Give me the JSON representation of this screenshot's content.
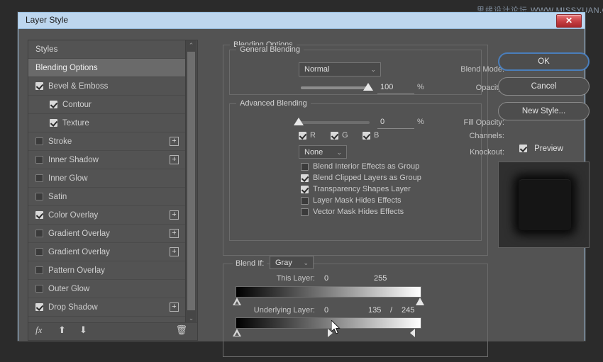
{
  "watermark": {
    "cn": "思缘设计论坛",
    "url": "WWW.MISSYUAN.COM"
  },
  "dialog": {
    "title": "Layer Style",
    "close_label": "✕"
  },
  "styles_panel": {
    "header": "Styles",
    "items": [
      {
        "label": "Blending Options",
        "checkbox": null,
        "checked": false,
        "selected": true,
        "indent": false,
        "plus": false
      },
      {
        "label": "Bevel & Emboss",
        "checkbox": true,
        "checked": true,
        "selected": false,
        "indent": false,
        "plus": false
      },
      {
        "label": "Contour",
        "checkbox": true,
        "checked": true,
        "selected": false,
        "indent": true,
        "plus": false
      },
      {
        "label": "Texture",
        "checkbox": true,
        "checked": true,
        "selected": false,
        "indent": true,
        "plus": false
      },
      {
        "label": "Stroke",
        "checkbox": true,
        "checked": false,
        "selected": false,
        "indent": false,
        "plus": true
      },
      {
        "label": "Inner Shadow",
        "checkbox": true,
        "checked": false,
        "selected": false,
        "indent": false,
        "plus": true
      },
      {
        "label": "Inner Glow",
        "checkbox": true,
        "checked": false,
        "selected": false,
        "indent": false,
        "plus": false
      },
      {
        "label": "Satin",
        "checkbox": true,
        "checked": false,
        "selected": false,
        "indent": false,
        "plus": false
      },
      {
        "label": "Color Overlay",
        "checkbox": true,
        "checked": true,
        "selected": false,
        "indent": false,
        "plus": true
      },
      {
        "label": "Gradient Overlay",
        "checkbox": true,
        "checked": false,
        "selected": false,
        "indent": false,
        "plus": true
      },
      {
        "label": "Gradient Overlay",
        "checkbox": true,
        "checked": false,
        "selected": false,
        "indent": false,
        "plus": true
      },
      {
        "label": "Pattern Overlay",
        "checkbox": true,
        "checked": false,
        "selected": false,
        "indent": false,
        "plus": false
      },
      {
        "label": "Outer Glow",
        "checkbox": true,
        "checked": false,
        "selected": false,
        "indent": false,
        "plus": false
      },
      {
        "label": "Drop Shadow",
        "checkbox": true,
        "checked": true,
        "selected": false,
        "indent": false,
        "plus": true
      }
    ],
    "plus_glyph": "+",
    "tools": {
      "fx": "fx",
      "move_up": "⬆",
      "move_down": "⬇",
      "delete": "🗑"
    },
    "scrollbar": {
      "up": "⌃",
      "down": "⌄"
    }
  },
  "center": {
    "blending_options_caption": "Blending Options",
    "general_blending": {
      "caption": "General Blending",
      "blend_mode_label": "Blend Mode:",
      "blend_mode_value": "Normal",
      "opacity_label": "Opacity:",
      "opacity_value": "100",
      "opacity_unit": "%"
    },
    "advanced_blending": {
      "caption": "Advanced Blending",
      "fill_opacity_label": "Fill Opacity:",
      "fill_opacity_value": "0",
      "fill_opacity_unit": "%",
      "channels_label": "Channels:",
      "channels": [
        {
          "label": "R",
          "checked": true
        },
        {
          "label": "G",
          "checked": true
        },
        {
          "label": "B",
          "checked": true
        }
      ],
      "knockout_label": "Knockout:",
      "knockout_value": "None",
      "options": [
        {
          "label": "Blend Interior Effects as Group",
          "checked": false
        },
        {
          "label": "Blend Clipped Layers as Group",
          "checked": true
        },
        {
          "label": "Transparency Shapes Layer",
          "checked": true
        },
        {
          "label": "Layer Mask Hides Effects",
          "checked": false
        },
        {
          "label": "Vector Mask Hides Effects",
          "checked": false
        }
      ]
    },
    "blend_if": {
      "label": "Blend If:",
      "channel_value": "Gray",
      "this_layer": {
        "label": "This Layer:",
        "low": "0",
        "high": "255"
      },
      "underlying_layer": {
        "label": "Underlying Layer:",
        "low": "0",
        "high_a": "135",
        "separator": "/",
        "high_b": "245"
      }
    },
    "chevron": "⌄"
  },
  "right": {
    "ok": "OK",
    "cancel": "Cancel",
    "new_style": "New Style...",
    "preview_label": "Preview",
    "preview_checked": true
  },
  "colors": {
    "titlebar": "#bdd6ee",
    "dialog_bg": "#535353",
    "accent_blue": "#4a7ebb",
    "close_red": "#c43e42"
  }
}
